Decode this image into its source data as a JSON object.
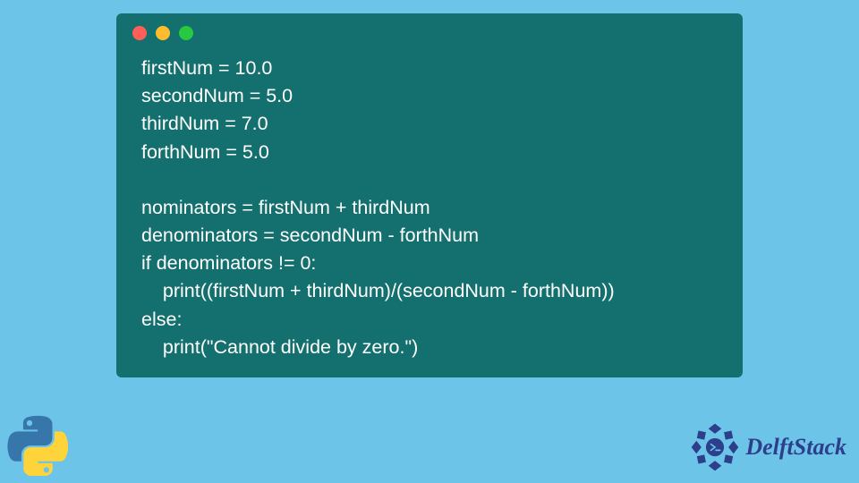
{
  "code": {
    "lines": [
      "firstNum = 10.0",
      "secondNum = 5.0",
      "thirdNum = 7.0",
      "forthNum = 5.0",
      "",
      "nominators = firstNum + thirdNum",
      "denominators = secondNum - forthNum",
      "if denominators != 0:",
      "    print((firstNum + thirdNum)/(secondNum - forthNum))",
      "else:",
      "    print(\"Cannot divide by zero.\")"
    ]
  },
  "brand": {
    "name": "DelftStack"
  },
  "colors": {
    "page_bg": "#6cc4e8",
    "window_bg": "#14706e",
    "code_text": "#ffffff",
    "brand_text": "#2d3e8b"
  }
}
